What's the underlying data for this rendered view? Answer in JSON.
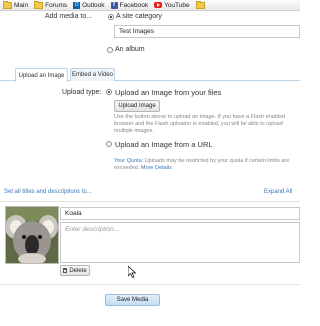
{
  "bookmarks": [
    {
      "label": "Main",
      "icon": "folder-icon"
    },
    {
      "label": "Forums",
      "icon": "folder-icon"
    },
    {
      "label": "Outlook",
      "icon": "outlook-icon"
    },
    {
      "label": "Facebook",
      "icon": "facebook-icon"
    },
    {
      "label": "YouTube",
      "icon": "youtube-icon"
    },
    {
      "label": "",
      "icon": "folder-icon"
    }
  ],
  "add_media": {
    "label": "Add media to...",
    "option_site_category": "A site category",
    "category_value": "Test Images",
    "option_album": "An album"
  },
  "tabs": {
    "upload_image": "Upload an Image",
    "embed_video": "Embed a Video"
  },
  "upload": {
    "type_label": "Upload type:",
    "option_files": "Upload an Image from your files",
    "button": "Upload Image",
    "help": "Use the button above to upload an image. If you have a Flash enabled browser and the Flash uploader is enabled, you will be able to upload multiple images.",
    "option_url": "Upload an Image from a URL",
    "quota_label": "Your Quota:",
    "quota_text": "Uploads may be restricted by your quota if certain limits are exceeded.",
    "more_details": "More Details"
  },
  "list": {
    "set_all": "Set all titles and descriptions to...",
    "expand_all": "Expand All"
  },
  "item": {
    "title": "Koala",
    "description_placeholder": "Enter description...",
    "delete": "Delete"
  },
  "save": "Save Media",
  "colors": {
    "accent_link": "#3a78b5",
    "save_button": "#cfe3f3"
  }
}
